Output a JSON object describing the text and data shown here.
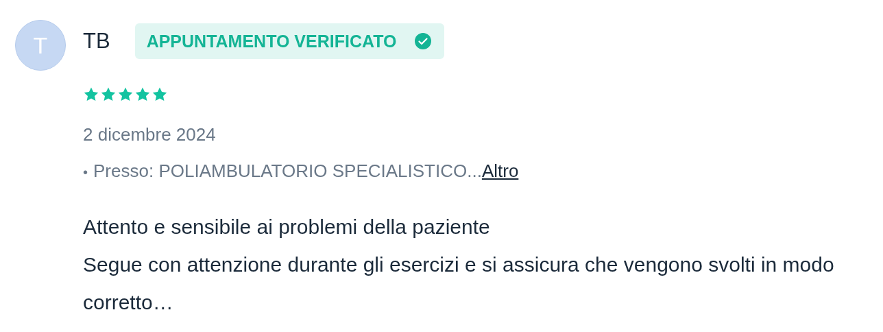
{
  "review": {
    "avatar_initial": "T",
    "author": "TB",
    "badge": {
      "label": "APPUNTAMENTO VERIFICATO",
      "verified": true
    },
    "stars": 5,
    "date": "2 dicembre 2024",
    "location": {
      "bullet": "•",
      "text": "Presso: POLIAMBULATORIO SPECIALISTICO...",
      "link": "Altro"
    },
    "body": [
      "Attento e sensibile ai problemi della paziente",
      "Segue con attenzione durante gli esercizi e si assicura che vengono svolti in modo corretto…"
    ]
  }
}
